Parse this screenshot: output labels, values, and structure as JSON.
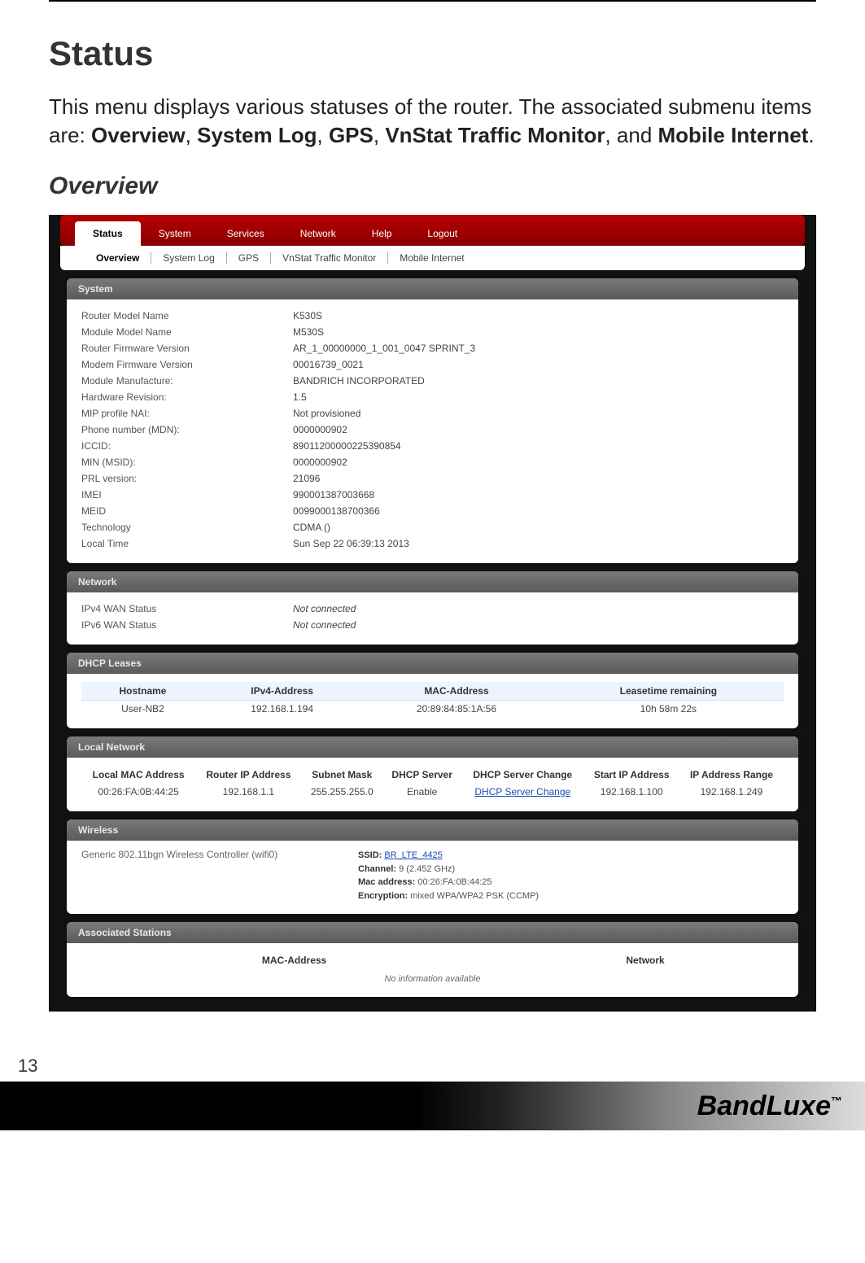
{
  "doc": {
    "title": "Status",
    "intro_prefix": "This menu displays various statuses of the router. The associated submenu items are: ",
    "intro_items": [
      "Overview",
      "System Log",
      "GPS",
      "VnStat Traffic Monitor",
      "Mobile Internet"
    ],
    "intro_joiner_comma": ", ",
    "intro_joiner_and": ", and ",
    "intro_suffix": ".",
    "subtitle": "Overview",
    "page_number": "13",
    "brand": "BandLuxe",
    "brand_tm": "™"
  },
  "tabs": {
    "top": [
      "Status",
      "System",
      "Services",
      "Network",
      "Help",
      "Logout"
    ],
    "active_top": "Status",
    "sub": [
      "Overview",
      "System Log",
      "GPS",
      "VnStat Traffic Monitor",
      "Mobile Internet"
    ],
    "active_sub": "Overview"
  },
  "panels": {
    "system": {
      "title": "System",
      "rows": [
        {
          "label": "Router Model Name",
          "value": "K530S"
        },
        {
          "label": "Module Model Name",
          "value": "M530S"
        },
        {
          "label": "Router Firmware Version",
          "value": "AR_1_00000000_1_001_0047 SPRINT_3"
        },
        {
          "label": "Modem Firmware Version",
          "value": "00016739_0021"
        },
        {
          "label": "Module Manufacture:",
          "value": "BANDRICH INCORPORATED"
        },
        {
          "label": "Hardware Revision:",
          "value": "1.5"
        },
        {
          "label": "MIP profile NAI:",
          "value": "Not provisioned"
        },
        {
          "label": "Phone number (MDN):",
          "value": "0000000902"
        },
        {
          "label": "ICCID:",
          "value": "89011200000225390854"
        },
        {
          "label": "MIN (MSID):",
          "value": "0000000902"
        },
        {
          "label": "PRL version:",
          "value": "21096"
        },
        {
          "label": "IMEI",
          "value": "990001387003668"
        },
        {
          "label": "MEID",
          "value": "0099000138700366"
        },
        {
          "label": "Technology",
          "value": "CDMA ()"
        },
        {
          "label": "Local Time",
          "value": "Sun Sep 22 06:39:13 2013"
        }
      ]
    },
    "network": {
      "title": "Network",
      "rows": [
        {
          "label": "IPv4 WAN Status",
          "value": "Not connected"
        },
        {
          "label": "IPv6 WAN Status",
          "value": "Not connected"
        }
      ]
    },
    "dhcp": {
      "title": "DHCP Leases",
      "headers": [
        "Hostname",
        "IPv4-Address",
        "MAC-Address",
        "Leasetime remaining"
      ],
      "rows": [
        [
          "User-NB2",
          "192.168.1.194",
          "20:89:84:85:1A:56",
          "10h 58m 22s"
        ]
      ]
    },
    "local": {
      "title": "Local Network",
      "headers": [
        "Local MAC Address",
        "Router IP Address",
        "Subnet Mask",
        "DHCP Server",
        "DHCP Server Change",
        "Start IP Address",
        "IP Address Range"
      ],
      "row": [
        "00:26:FA:0B:44:25",
        "192.168.1.1",
        "255.255.255.0",
        "Enable",
        "DHCP Server Change",
        "192.168.1.100",
        "192.168.1.249"
      ]
    },
    "wireless": {
      "title": "Wireless",
      "controller": "Generic 802.11bgn Wireless Controller (wifi0)",
      "ssid_label": "SSID:",
      "ssid": "BR_LTE_4425",
      "channel_label": "Channel:",
      "channel": "9 (2.452 GHz)",
      "mac_label": "Mac address:",
      "mac": "00:26:FA:0B:44:25",
      "enc_label": "Encryption:",
      "enc": "mixed WPA/WPA2 PSK (CCMP)"
    },
    "assoc": {
      "title": "Associated Stations",
      "headers": [
        "MAC-Address",
        "Network"
      ],
      "empty": "No information available"
    }
  }
}
